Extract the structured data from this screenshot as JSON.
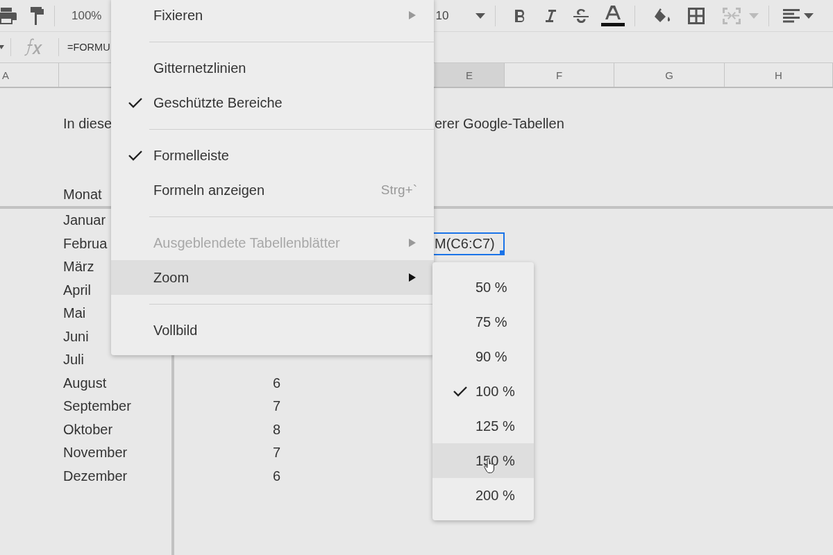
{
  "toolbar": {
    "zoom": "100%",
    "font_size": "10"
  },
  "formula_bar": {
    "formula": "=FORMU"
  },
  "column_headers": [
    {
      "label": "A",
      "selected": false
    },
    {
      "label": "E",
      "selected": true
    },
    {
      "label": "F",
      "selected": false
    },
    {
      "label": "G",
      "selected": false
    },
    {
      "label": "H",
      "selected": false
    }
  ],
  "intro": [
    "In diese",
    "erer Google-Tabellen"
  ],
  "table_header": "Monat",
  "rows": [
    {
      "month": "Januar"
    },
    {
      "month": "Februa",
      "selected_cell": "M(C6:C7)"
    },
    {
      "month": "März"
    },
    {
      "month": "April"
    },
    {
      "month": "Mai"
    },
    {
      "month": "Juni"
    },
    {
      "month": "Juli"
    },
    {
      "month": "August",
      "value": "6"
    },
    {
      "month": "September",
      "value": "7"
    },
    {
      "month": "Oktober",
      "value": "8"
    },
    {
      "month": "November",
      "value": "7"
    },
    {
      "month": "Dezember",
      "value": "6"
    }
  ],
  "view_menu": {
    "items": [
      {
        "kind": "item",
        "label": "Fixieren",
        "checked": false,
        "disabled": false,
        "highlighted": false,
        "submenu": true
      },
      {
        "kind": "separator"
      },
      {
        "kind": "item",
        "label": "Gitternetzlinien",
        "checked": false,
        "disabled": false,
        "highlighted": false,
        "submenu": false
      },
      {
        "kind": "item",
        "label": "Geschützte Bereiche",
        "checked": true,
        "disabled": false,
        "highlighted": false,
        "submenu": false
      },
      {
        "kind": "separator"
      },
      {
        "kind": "item",
        "label": "Formelleiste",
        "checked": true,
        "disabled": false,
        "highlighted": false,
        "submenu": false
      },
      {
        "kind": "item",
        "label": "Formeln anzeigen",
        "shortcut": "Strg+`",
        "checked": false,
        "disabled": false,
        "highlighted": false,
        "submenu": false
      },
      {
        "kind": "separator"
      },
      {
        "kind": "item",
        "label": "Ausgeblendete Tabellenblätter",
        "checked": false,
        "disabled": true,
        "highlighted": false,
        "submenu": true
      },
      {
        "kind": "item",
        "label": "Zoom",
        "checked": false,
        "disabled": false,
        "highlighted": true,
        "submenu": true
      },
      {
        "kind": "separator"
      },
      {
        "kind": "item",
        "label": "Vollbild",
        "checked": false,
        "disabled": false,
        "highlighted": false,
        "submenu": false
      }
    ]
  },
  "zoom_menu": {
    "items": [
      {
        "label": "50 %",
        "checked": false,
        "highlighted": false
      },
      {
        "label": "75 %",
        "checked": false,
        "highlighted": false
      },
      {
        "label": "90 %",
        "checked": false,
        "highlighted": false
      },
      {
        "label": "100 %",
        "checked": true,
        "highlighted": false
      },
      {
        "label": "125 %",
        "checked": false,
        "highlighted": false
      },
      {
        "label": "150 %",
        "checked": false,
        "highlighted": true
      },
      {
        "label": "200 %",
        "checked": false,
        "highlighted": false
      }
    ]
  }
}
